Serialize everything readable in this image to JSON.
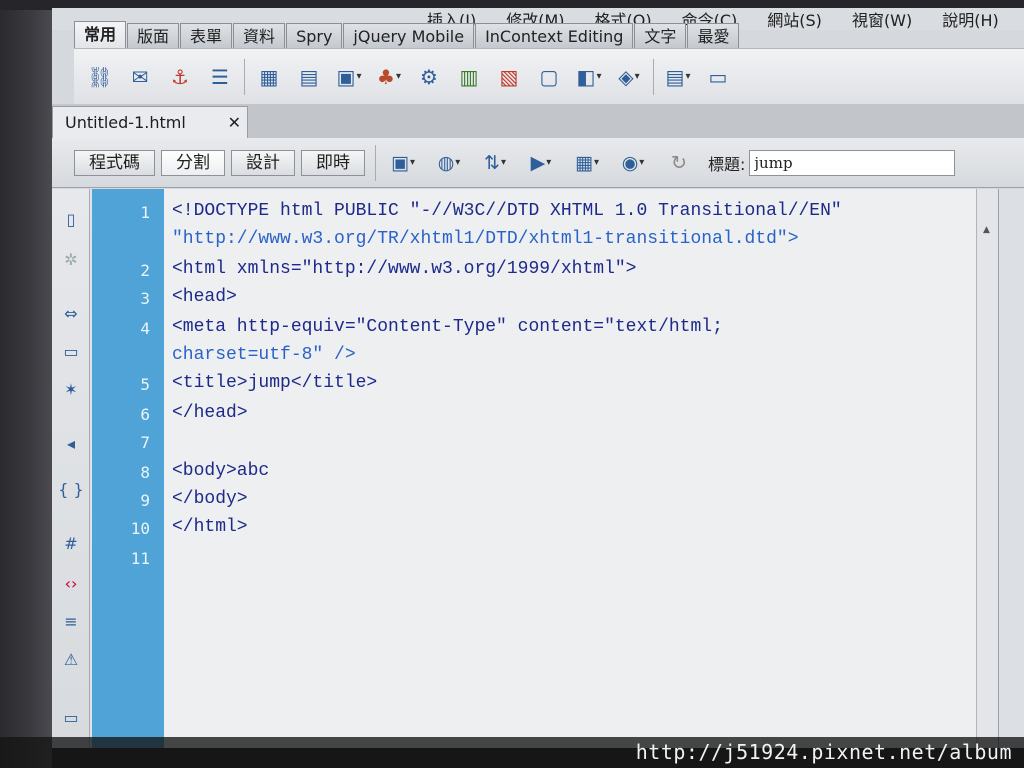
{
  "menubar": {
    "items": [
      "插入(I)",
      "修改(M)",
      "格式(O)",
      "命令(C)",
      "網站(S)",
      "視窗(W)",
      "說明(H)"
    ]
  },
  "insert_categories": [
    "常用",
    "版面",
    "表單",
    "資料",
    "Spry",
    "jQuery Mobile",
    "InContext Editing",
    "文字",
    "最愛"
  ],
  "insert_toolbar": {
    "icons": [
      "hyperlink-icon",
      "email-link-icon",
      "named-anchor-icon",
      "horizontal-rule-icon",
      "table-icon",
      "insert-div-icon",
      "images-icon",
      "media-icon",
      "widget-icon",
      "date-icon",
      "server-side-include-icon",
      "comment-icon",
      "head-icon",
      "script-icon",
      "templates-icon",
      "tag-chooser-icon"
    ]
  },
  "document": {
    "tab_name": "Untitled-1.html",
    "close_glyph": "✕"
  },
  "view_buttons": [
    "程式碼",
    "分割",
    "設計",
    "即時"
  ],
  "doc_toolbar": {
    "title_label": "標題:",
    "title_value": "jump"
  },
  "code": {
    "lines": [
      {
        "num": "1",
        "text": "<!DOCTYPE html PUBLIC \"-//W3C//DTD XHTML 1.0 Transitional//EN\""
      },
      {
        "num": "",
        "text": "\"http://www.w3.org/TR/xhtml1/DTD/xhtml1-transitional.dtd\">"
      },
      {
        "num": "2",
        "text": "<html xmlns=\"http://www.w3.org/1999/xhtml\">"
      },
      {
        "num": "3",
        "text": "<head>"
      },
      {
        "num": "4",
        "text": "<meta http-equiv=\"Content-Type\" content=\"text/html;"
      },
      {
        "num": "",
        "text": "charset=utf-8\" />"
      },
      {
        "num": "5",
        "text": "<title>jump</title>"
      },
      {
        "num": "6",
        "text": "</head>"
      },
      {
        "num": "7",
        "text": ""
      },
      {
        "num": "8",
        "text": "<body>abc"
      },
      {
        "num": "9",
        "text": "</body>"
      },
      {
        "num": "10",
        "text": "</html>"
      },
      {
        "num": "11",
        "text": ""
      }
    ]
  },
  "watermark": "http://j51924.pixnet.net/album",
  "colors": {
    "gutter": "#4fa3d6",
    "tag": "#1d2a8a",
    "value": "#2a63c8"
  }
}
